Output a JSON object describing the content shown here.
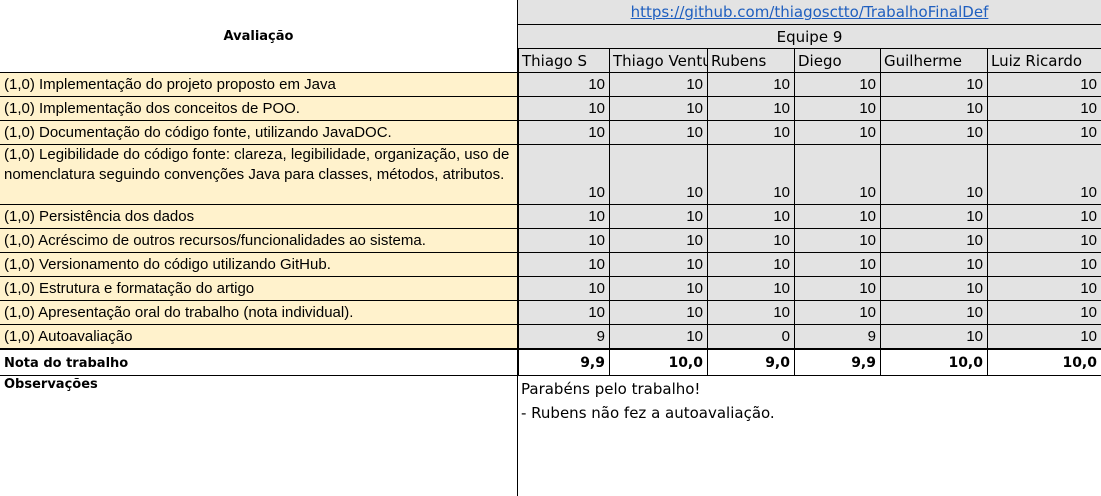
{
  "header": {
    "avaliacao_title": "Avaliação",
    "repo_link": "https://github.com/thiagosctto/TrabalhoFinalDef",
    "team": "Equipe 9",
    "students": [
      "Thiago S",
      "Thiago Ventu",
      "Rubens",
      "Diego",
      "Guilherme",
      "Luiz Ricardo"
    ]
  },
  "criteria": [
    {
      "label": "(1,0) Implementação do projeto proposto em Java",
      "scores": [
        "10",
        "10",
        "10",
        "10",
        "10",
        "10"
      ]
    },
    {
      "label": "(1,0) Implementação dos conceitos de POO.",
      "scores": [
        "10",
        "10",
        "10",
        "10",
        "10",
        "10"
      ]
    },
    {
      "label": "(1,0) Documentação do código fonte, utilizando JavaDOC.",
      "scores": [
        "10",
        "10",
        "10",
        "10",
        "10",
        "10"
      ]
    },
    {
      "label": "(1,0) Legibilidade do código fonte: clareza, legibilidade, organização, uso de nomenclatura seguindo convenções Java para classes, métodos, atributos.",
      "scores": [
        "10",
        "10",
        "10",
        "10",
        "10",
        "10"
      ]
    },
    {
      "label": "(1,0) Persistência dos dados",
      "scores": [
        "10",
        "10",
        "10",
        "10",
        "10",
        "10"
      ]
    },
    {
      "label": "(1,0) Acréscimo de outros recursos/funcionalidades ao sistema.",
      "scores": [
        "10",
        "10",
        "10",
        "10",
        "10",
        "10"
      ]
    },
    {
      "label": "(1,0) Versionamento do código utilizando GitHub.",
      "scores": [
        "10",
        "10",
        "10",
        "10",
        "10",
        "10"
      ]
    },
    {
      "label": "(1,0) Estrutura e formatação do artigo",
      "scores": [
        "10",
        "10",
        "10",
        "10",
        "10",
        "10"
      ]
    },
    {
      "label": "(1,0) Apresentação oral do trabalho (nota individual).",
      "scores": [
        "10",
        "10",
        "10",
        "10",
        "10",
        "10"
      ]
    },
    {
      "label": "(1,0) Autoavaliação",
      "scores": [
        "9",
        "10",
        "0",
        "9",
        "10",
        "10"
      ]
    }
  ],
  "total": {
    "label": "Nota do trabalho",
    "scores": [
      "9,9",
      "10,0",
      "9,0",
      "9,9",
      "10,0",
      "10,0"
    ]
  },
  "observations": {
    "label": "Observações",
    "lines": [
      "Parabéns pelo trabalho!",
      "- Rubens não fez a autoavaliação."
    ]
  }
}
